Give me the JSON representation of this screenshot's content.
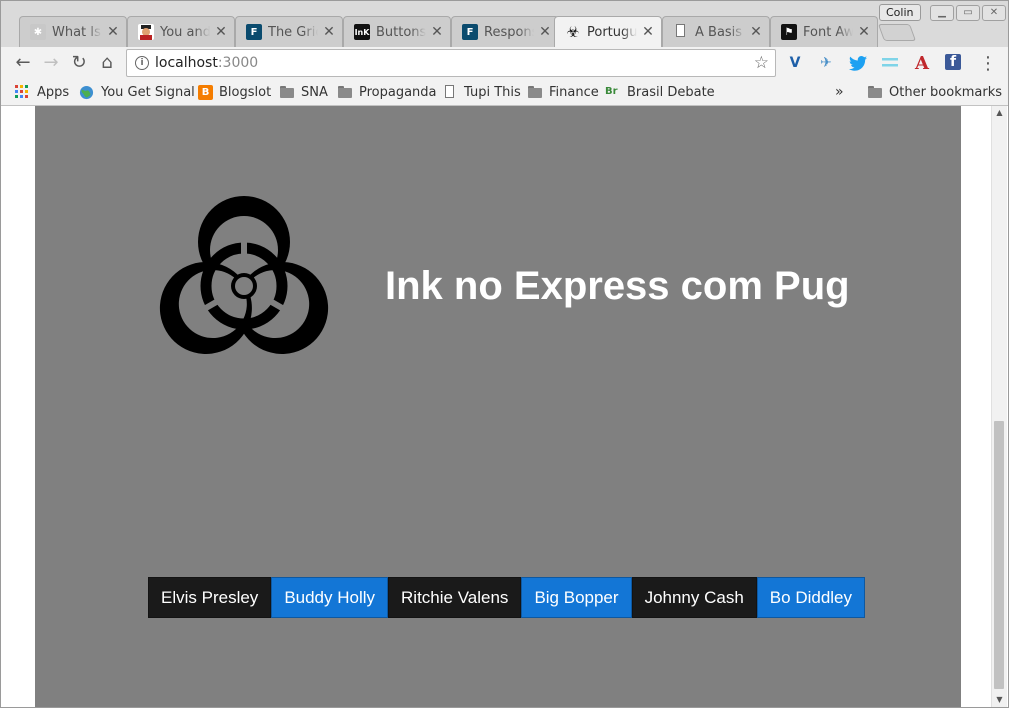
{
  "profile_name": "Colin",
  "tabs": [
    {
      "title": "What Is Ink?",
      "icon": "puzzle-icon",
      "active": false
    },
    {
      "title": "You and Your Avatar",
      "icon": "avatar-icon",
      "active": false
    },
    {
      "title": "The Grid",
      "icon": "f-logo-icon",
      "active": false
    },
    {
      "title": "Buttons",
      "icon": "ink-logo-icon",
      "active": false
    },
    {
      "title": "Responsive",
      "icon": "f-logo-icon",
      "active": false
    },
    {
      "title": "Português",
      "icon": "biohazard-icon",
      "active": true
    },
    {
      "title": "A Basis",
      "icon": "page-icon",
      "active": false
    },
    {
      "title": "Font Awesome",
      "icon": "flag-icon",
      "active": false
    }
  ],
  "toolbar": {
    "url_host": "localhost",
    "url_port": ":3000"
  },
  "bookmarks": [
    {
      "label": "Apps",
      "icon": "apps-grid-icon"
    },
    {
      "label": "You Get Signal",
      "icon": "globe-icon"
    },
    {
      "label": "Blogslot",
      "icon": "blogger-icon"
    },
    {
      "label": "SNA",
      "icon": "folder-icon"
    },
    {
      "label": "Propaganda",
      "icon": "folder-icon"
    },
    {
      "label": "Tupi This",
      "icon": "page-icon"
    },
    {
      "label": "Finance",
      "icon": "folder-icon"
    },
    {
      "label": "Brasil Debate",
      "icon": "brasil-debate-icon"
    }
  ],
  "bookmarks_overflow": "»",
  "other_bookmarks": "Other bookmarks",
  "page": {
    "title": "Ink no Express com Pug",
    "background": "#808080",
    "buttons": [
      {
        "label": "Elvis Presley",
        "style": "dark"
      },
      {
        "label": "Buddy Holly",
        "style": "blue"
      },
      {
        "label": "Ritchie Valens",
        "style": "dark"
      },
      {
        "label": "Big Bopper",
        "style": "blue"
      },
      {
        "label": "Johnny Cash",
        "style": "dark"
      },
      {
        "label": "Bo Diddley",
        "style": "blue"
      }
    ]
  },
  "colors": {
    "dark_button": "#1a1a1a",
    "blue_button": "#1376d6"
  }
}
